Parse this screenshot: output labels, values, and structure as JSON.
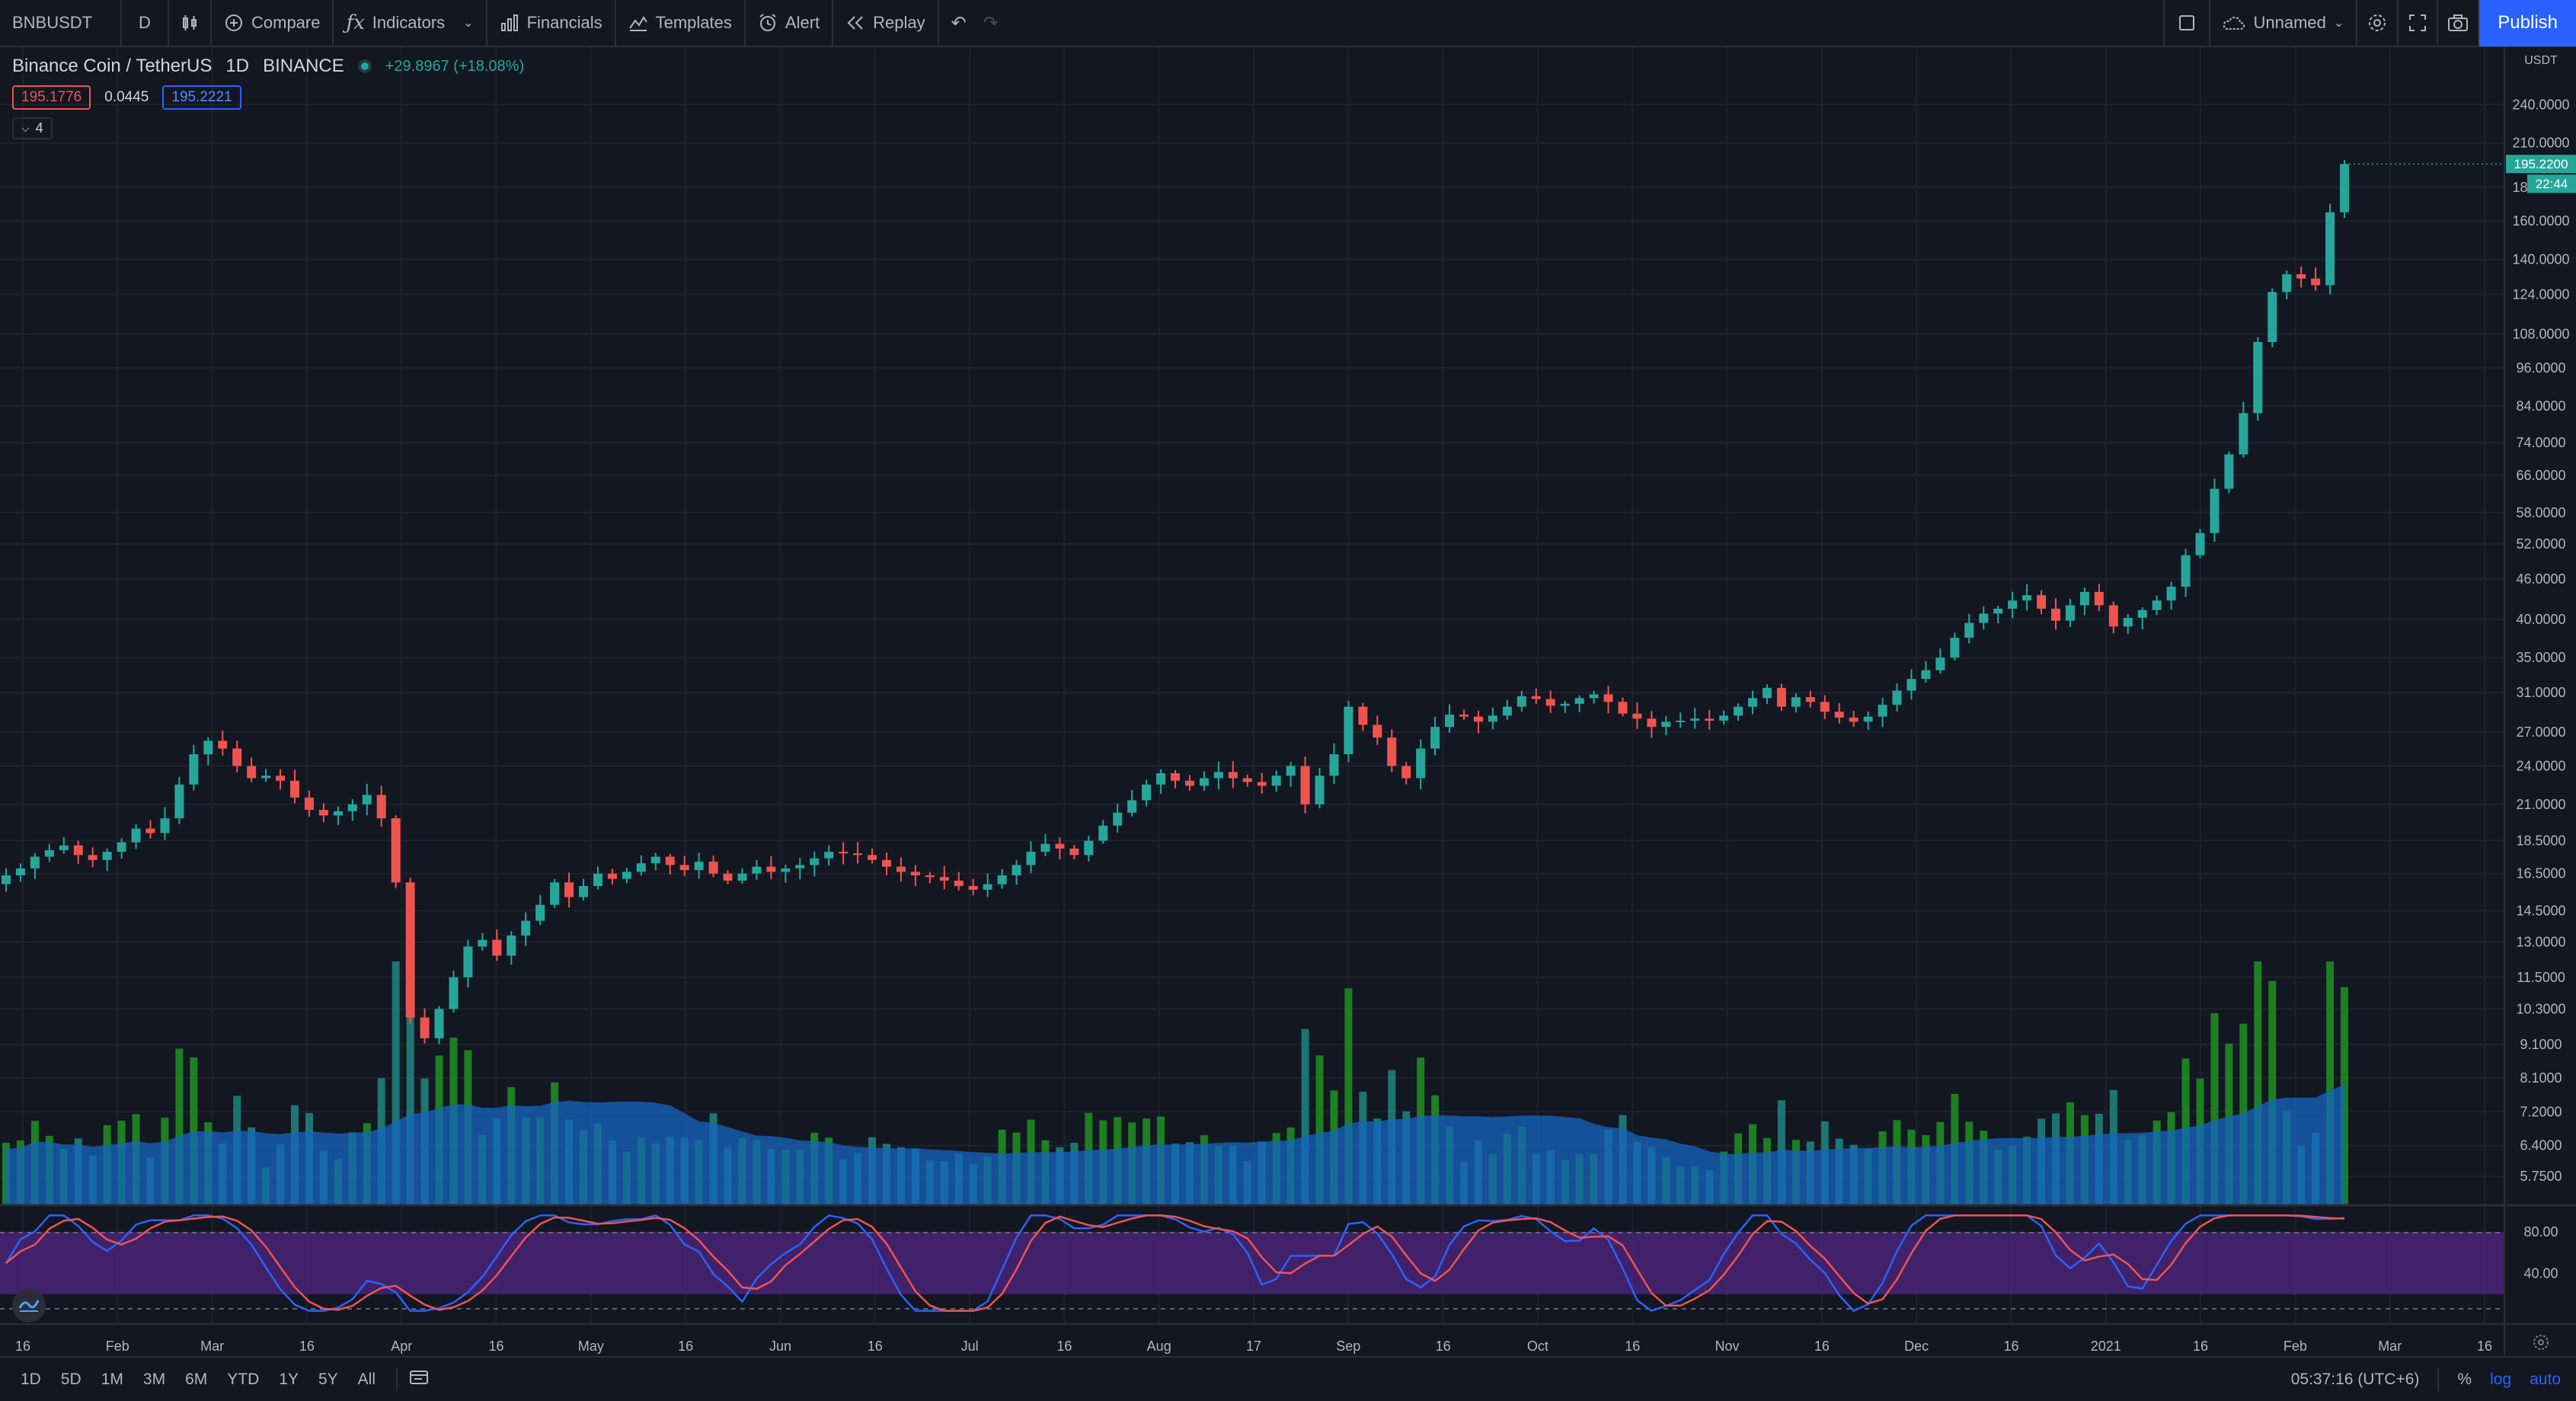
{
  "toolbar": {
    "symbol": "BNBUSDT",
    "interval": "D",
    "compare": "Compare",
    "indicators": "Indicators",
    "financials": "Financials",
    "templates": "Templates",
    "alert": "Alert",
    "replay": "Replay",
    "layout_name": "Unnamed",
    "publish": "Publish"
  },
  "legend": {
    "title": "Binance Coin / TetherUS",
    "interval": "1D",
    "exchange": "BINANCE",
    "change": "+29.8967 (+18.08%)",
    "bid": "195.1776",
    "spread": "0.0445",
    "ask": "195.2221",
    "collapsed_count": "4"
  },
  "price_axis": {
    "currency": "USDT",
    "labels": [
      "240.0000",
      "210.0000",
      "180.0000",
      "160.0000",
      "140.0000",
      "124.0000",
      "108.0000",
      "96.0000",
      "84.0000",
      "74.0000",
      "66.0000",
      "58.0000",
      "52.0000",
      "46.0000",
      "40.0000",
      "35.0000",
      "31.0000",
      "27.0000",
      "24.0000",
      "21.0000",
      "18.5000",
      "16.5000",
      "14.5000",
      "13.0000",
      "11.5000",
      "10.3000",
      "9.1000",
      "8.1000",
      "7.2000",
      "6.4000",
      "5.7500"
    ],
    "current_price": "195.2200",
    "countdown": "22:44"
  },
  "rsi_axis": {
    "labels": [
      "80.00",
      "40.00"
    ]
  },
  "time_axis": {
    "labels": [
      "16",
      "Feb",
      "Mar",
      "16",
      "Apr",
      "16",
      "May",
      "16",
      "Jun",
      "16",
      "Jul",
      "16",
      "Aug",
      "17",
      "Sep",
      "16",
      "Oct",
      "16",
      "Nov",
      "16",
      "Dec",
      "16",
      "2021",
      "16",
      "Feb",
      "Mar",
      "16"
    ]
  },
  "bottombar": {
    "ranges": [
      "1D",
      "5D",
      "1M",
      "3M",
      "6M",
      "YTD",
      "1Y",
      "5Y",
      "All"
    ],
    "clock": "05:37:16 (UTC+6)",
    "percent": "%",
    "log": "log",
    "auto": "auto"
  },
  "colors": {
    "up": "#26a69a",
    "down": "#ef5350",
    "volume_up": "#1f8a22",
    "volume_ma": "#1565c0",
    "rsi_band": "#4a2377",
    "rsi_k": "#2962ff",
    "rsi_d": "#ef5350"
  },
  "chart_data": {
    "type": "candlestick",
    "symbol": "BNBUSDT",
    "scale": "log",
    "ylim": [
      5.2,
      250
    ],
    "close": [
      16.4,
      16.8,
      17.5,
      17.9,
      18.2,
      17.6,
      17.3,
      17.8,
      18.4,
      19.3,
      19.0,
      20.0,
      22.5,
      25.0,
      26.2,
      25.5,
      24.0,
      23.0,
      23.2,
      22.8,
      21.5,
      20.6,
      20.2,
      20.5,
      21.0,
      21.7,
      20.0,
      16.0,
      10.0,
      9.3,
      10.3,
      11.5,
      12.8,
      13.1,
      12.4,
      13.3,
      14.0,
      14.8,
      16.0,
      15.2,
      15.8,
      16.5,
      16.2,
      16.6,
      17.1,
      17.5,
      17.0,
      16.7,
      17.2,
      16.5,
      16.1,
      16.5,
      16.9,
      16.6,
      16.8,
      17.0,
      17.4,
      17.8,
      17.7,
      17.6,
      17.3,
      16.9,
      16.6,
      16.4,
      16.3,
      16.1,
      15.8,
      15.6,
      15.9,
      16.4,
      17.0,
      17.8,
      18.3,
      18.0,
      17.6,
      18.5,
      19.5,
      20.4,
      21.3,
      22.5,
      23.4,
      22.8,
      22.4,
      23.0,
      23.5,
      23.0,
      22.7,
      22.4,
      23.2,
      24.0,
      21.0,
      23.2,
      25.0,
      29.5,
      27.7,
      26.5,
      24.0,
      23.0,
      25.5,
      27.5,
      28.7,
      28.5,
      28.0,
      28.6,
      29.5,
      30.6,
      30.3,
      29.6,
      29.8,
      30.4,
      30.8,
      30.0,
      28.8,
      28.3,
      27.5,
      28.0,
      28.1,
      28.3,
      28.1,
      28.6,
      29.5,
      30.4,
      31.5,
      29.5,
      30.5,
      30.0,
      29.0,
      28.4,
      28.0,
      28.5,
      29.7,
      31.2,
      32.5,
      33.5,
      35.0,
      37.5,
      39.5,
      40.8,
      41.5,
      42.7,
      43.5,
      41.5,
      39.8,
      42.0,
      44.0,
      42.0,
      39.0,
      40.2,
      41.3,
      42.7,
      44.8,
      50.0,
      54.0,
      63.0,
      71.0,
      82.0,
      105.0,
      125.0,
      133.0,
      131.0,
      128.0,
      165.0,
      195.2
    ],
    "last_price": 195.22
  }
}
